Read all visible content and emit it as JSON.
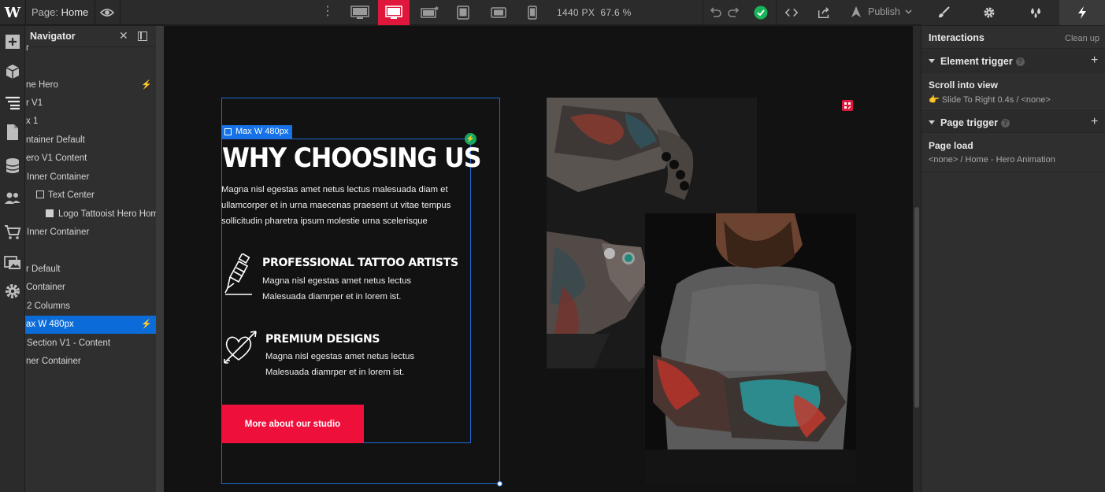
{
  "topbar": {
    "page_label": "Page:",
    "page_name": "Home",
    "canvas_width": "1440 PX",
    "zoom": "67.6 %",
    "publish_label": "Publish",
    "active_device": "desktop"
  },
  "navigator": {
    "title": "Navigator",
    "rows": [
      {
        "label": "r",
        "indent": 0
      },
      {
        "label": "ne Hero",
        "indent": 0,
        "bolt": true
      },
      {
        "label": "r V1",
        "indent": 0
      },
      {
        "label": "x 1",
        "indent": 0
      },
      {
        "label": "ntainer Default",
        "indent": 0
      },
      {
        "label": "ero V1 Content",
        "indent": 0
      },
      {
        "label": "Inner Container",
        "indent": 1
      },
      {
        "label": "Text Center",
        "indent": 2
      },
      {
        "label": "Logo Tattooist Hero Home",
        "indent": 3
      },
      {
        "label": "Inner Container",
        "indent": 1
      },
      {
        "label": "r Default",
        "indent": 0
      },
      {
        "label": "Container",
        "indent": 0
      },
      {
        "label": "2 Columns",
        "indent": 1
      },
      {
        "label": "ax W 480px",
        "indent": 0,
        "bolt": true,
        "selected": true
      },
      {
        "label": "Section V1 - Content",
        "indent": 1
      },
      {
        "label": "ner Container",
        "indent": 0
      }
    ]
  },
  "canvas": {
    "selection_tag": "Max W 480px",
    "heading": "WHY CHOOSING US",
    "paragraph": "Magna nisl egestas amet netus lectus malesuada diam et ullamcorper et in urna maecenas praesent ut vitae tempus sollicitudin pharetra ipsum molestie urna scelerisque",
    "features": [
      {
        "title": "PROFESSIONAL TATTOO ARTISTS",
        "line1": "Magna nisl egestas amet netus lectus",
        "line2": "Malesuada diamrper et in lorem ist.",
        "icon": "tattoo-machine-icon"
      },
      {
        "title": "PREMIUM DESIGNS",
        "line1": "Magna nisl egestas amet netus lectus",
        "line2": "Malesuada diamrper et in lorem ist.",
        "icon": "heart-arrow-icon"
      }
    ],
    "cta_label": "More about our studio",
    "accent": "#ee0f3a",
    "selection_color": "#1f6ad6"
  },
  "interactions": {
    "title": "Interactions",
    "clean_up": "Clean up",
    "element_trigger_label": "Element trigger",
    "element_trigger_name": "Scroll into view",
    "element_trigger_detail": "Slide To Right 0.4s / <none>",
    "page_trigger_label": "Page trigger",
    "page_trigger_name": "Page load",
    "page_trigger_detail": "<none> / Home - Hero Animation"
  }
}
